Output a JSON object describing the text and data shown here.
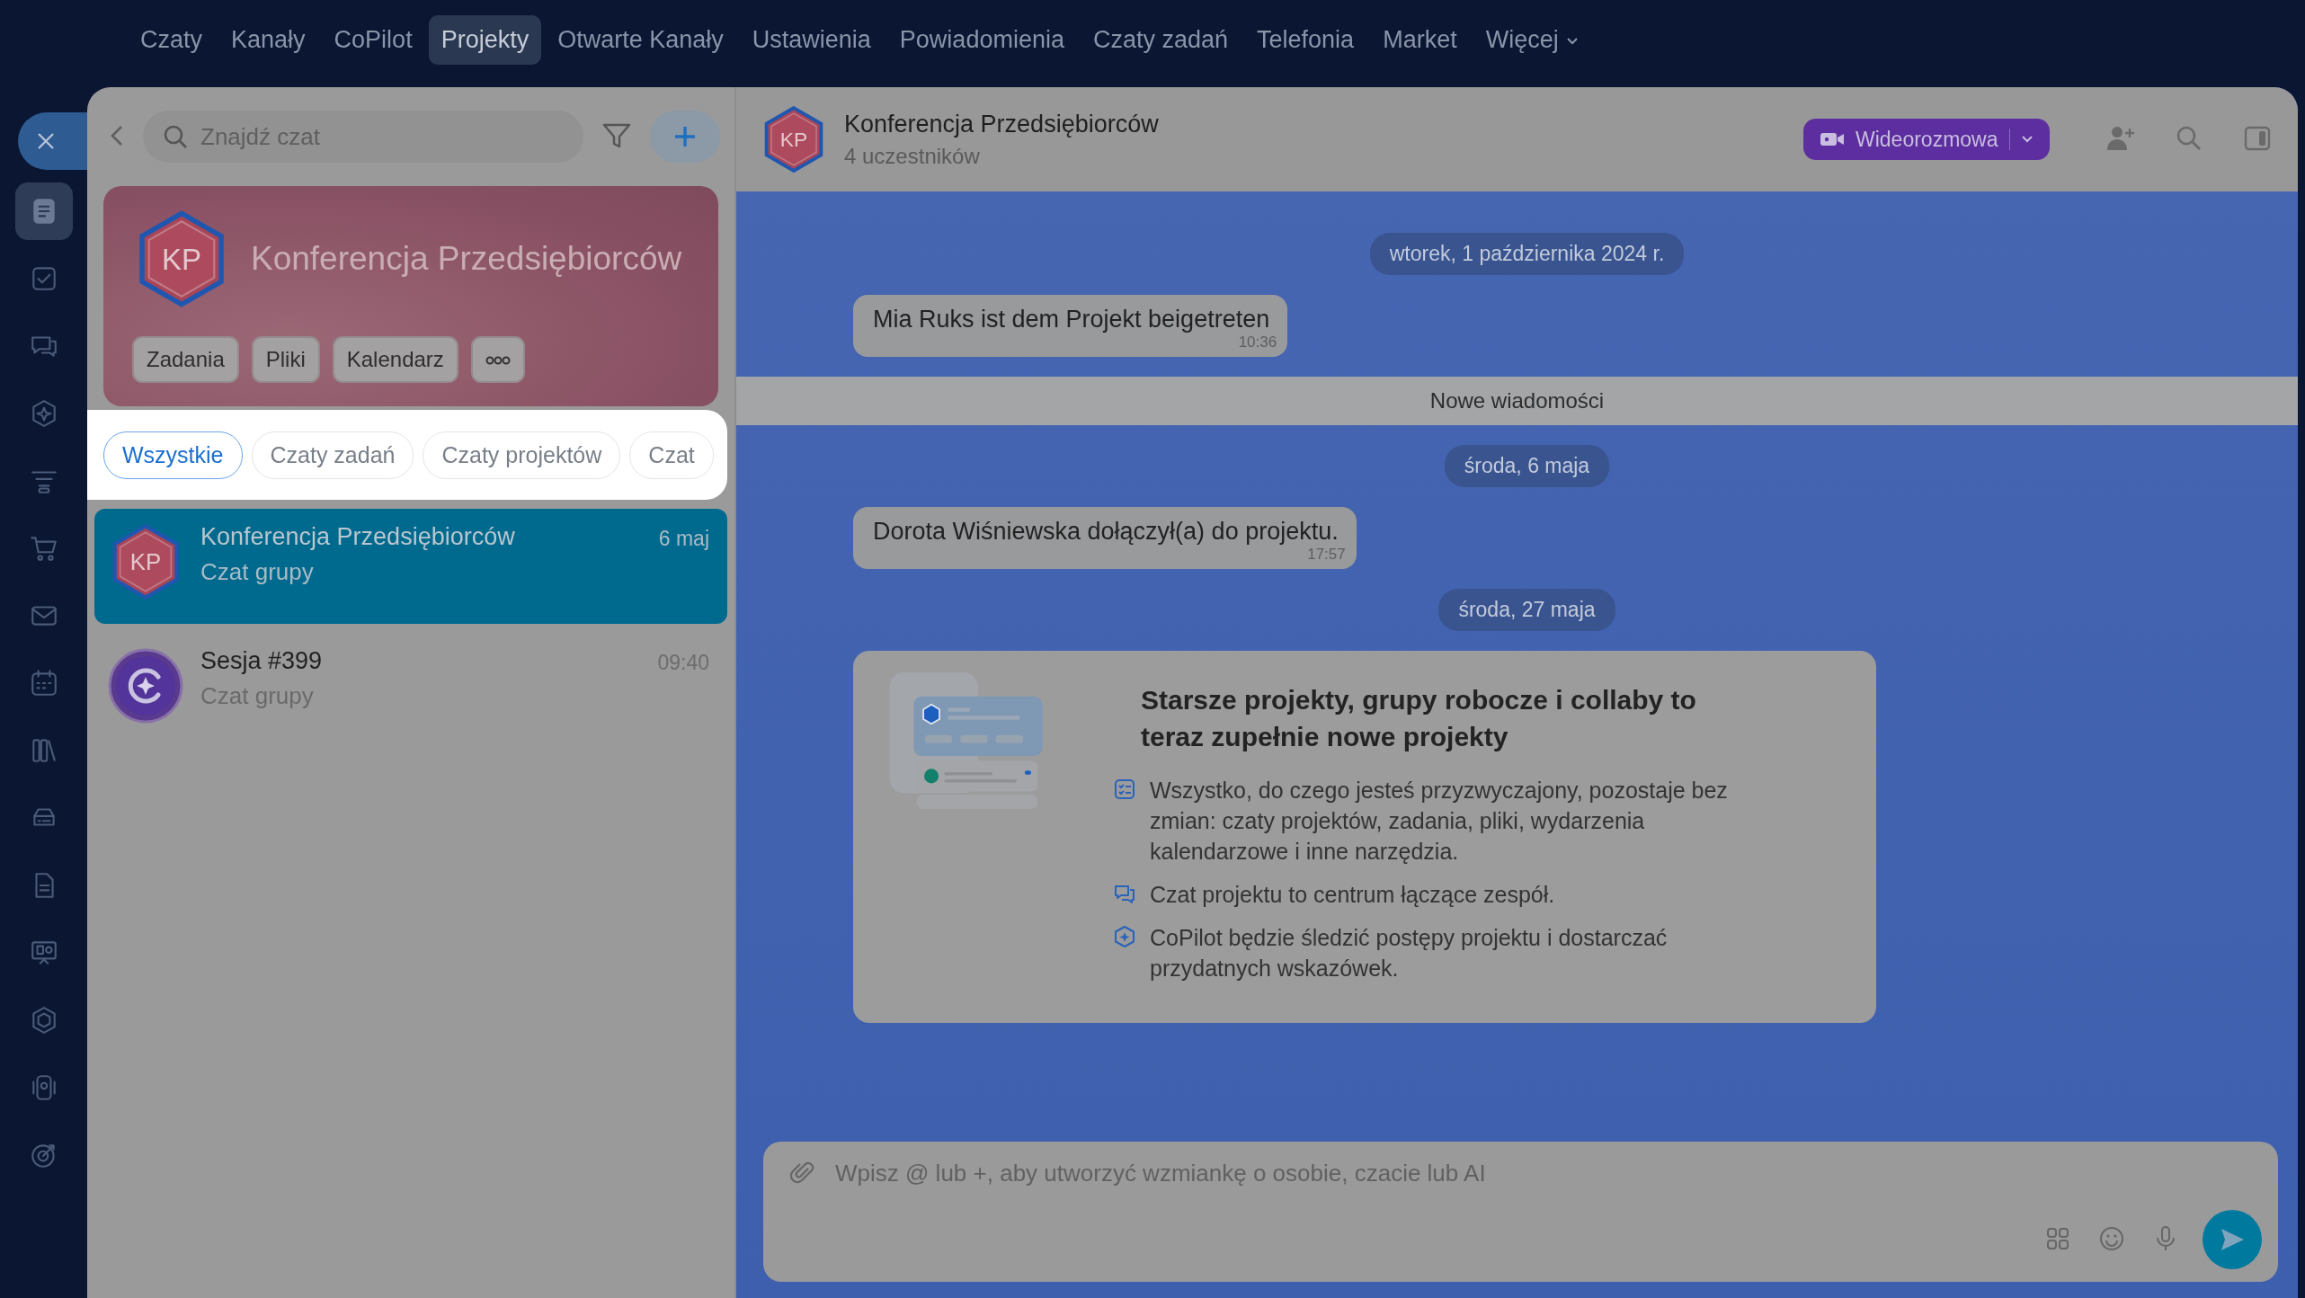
{
  "top_nav": [
    {
      "label": "Czaty",
      "kind": "link",
      "selected": false
    },
    {
      "label": "Kanały",
      "kind": "link",
      "selected": false
    },
    {
      "label": "CoPilot",
      "kind": "link",
      "selected": false
    },
    {
      "label": "Projekty",
      "kind": "link",
      "selected": true
    },
    {
      "label": "Otwarte Kanały",
      "kind": "link",
      "selected": false
    },
    {
      "label": "Ustawienia",
      "kind": "link",
      "selected": false
    },
    {
      "label": "Powiadomienia",
      "kind": "link",
      "selected": false
    },
    {
      "label": "Czaty zadań",
      "kind": "link",
      "selected": false
    },
    {
      "label": "Telefonia",
      "kind": "link",
      "selected": false
    },
    {
      "label": "Market",
      "kind": "link",
      "selected": false
    },
    {
      "label": "Więcej",
      "kind": "menu",
      "selected": false
    }
  ],
  "rail": [
    {
      "selected": true
    },
    {
      "selected": false
    },
    {
      "selected": false
    },
    {
      "selected": false
    },
    {
      "selected": false
    },
    {
      "selected": false
    },
    {
      "selected": false
    },
    {
      "selected": false
    },
    {
      "selected": false
    },
    {
      "selected": false
    },
    {
      "selected": false
    },
    {
      "selected": false
    },
    {
      "selected": false
    },
    {
      "selected": false
    },
    {
      "selected": false
    }
  ],
  "search": {
    "placeholder": "Znajdź czat"
  },
  "project_card": {
    "avatar": "KP",
    "title": "Konferencja Przedsiębiorców",
    "actions": [
      "Zadania",
      "Pliki",
      "Kalendarz"
    ]
  },
  "filters": [
    {
      "label": "Wszystkie",
      "selected": true
    },
    {
      "label": "Czaty zadań",
      "selected": false
    },
    {
      "label": "Czaty projektów",
      "selected": false
    },
    {
      "label": "Czat",
      "selected": false
    }
  ],
  "chats": [
    {
      "kind": "project",
      "avatar": "KP",
      "name": "Konferencja Przedsiębiorców",
      "time": "6 maj",
      "subtitle": "Czat grupy",
      "selected": true
    },
    {
      "kind": "copilot",
      "name": "Sesja #399",
      "time": "09:40",
      "subtitle": "Czat grupy",
      "selected": false
    }
  ],
  "chat_header": {
    "avatar": "KP",
    "title": "Konferencja Przedsiębiorców",
    "subtitle": "4 uczestników",
    "video_button": "Wideorozmowa"
  },
  "messages": [
    {
      "kind": "date",
      "text": "wtorek, 1 października 2024 r."
    },
    {
      "kind": "system",
      "text": "Mia Ruks ist dem Projekt beigetreten",
      "time": "10:36"
    },
    {
      "kind": "divider",
      "text": "Nowe wiadomości"
    },
    {
      "kind": "date",
      "text": "środa, 6 maja"
    },
    {
      "kind": "system",
      "text": "Dorota Wiśniewska dołączył(a) do projektu.",
      "time": "17:57"
    },
    {
      "kind": "date",
      "text": "środa, 27 maja"
    },
    {
      "kind": "info",
      "title": "Starsze projekty, grupy robocze i collaby to teraz zupełnie nowe projekty",
      "points": [
        "Wszystko, do czego jesteś przyzwyczajony, pozostaje bez zmian: czaty projektów, zadania, pliki, wydarzenia kalendarzowe i inne narzędzia.",
        "Czat projektu to centrum łączące zespół.",
        "CoPilot będzie śledzić postępy projektu i dostarczać przydatnych wskazówek."
      ]
    }
  ],
  "composer": {
    "placeholder": "Wpisz @ lub +, aby utworzyć wzmiankę o osobie, czacie lub AI"
  }
}
